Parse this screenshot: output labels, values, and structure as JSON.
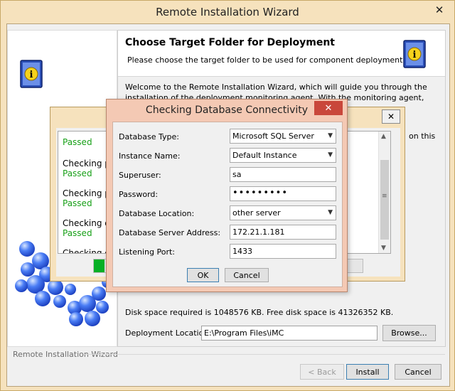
{
  "main": {
    "title": "Remote Installation Wizard",
    "close_glyph": "✕",
    "header_title": "Choose Target Folder for Deployment",
    "header_subtitle": "Please choose the target folder to be used for component deployment.",
    "intro_text": "Welcome to the Remote Installation Wizard, which will guide you through the installation of the deployment monitoring agent. With the monitoring agent, you can",
    "intro_tail": "on this",
    "disk_space": "Disk space required is 1048576 KB. Free disk space is 41326352 KB.",
    "deployment_location_label": "Deployment Location:",
    "deployment_location_value": "E:\\Program Files\\iMC",
    "browse_label": "Browse...",
    "footer_label": "Remote Installation Wizard",
    "back_label": "< Back",
    "install_label": "Install",
    "cancel_label": "Cancel"
  },
  "progress_dialog": {
    "close_glyph": "✕",
    "entries": [
      {
        "line1": "",
        "line2": "Passed"
      },
      {
        "line1": "Checking p",
        "line2": "Passed"
      },
      {
        "line1": "Checking p",
        "line2": "Passed"
      },
      {
        "line1": "Checking d",
        "line2": "Passed"
      },
      {
        "line1": "Checking d",
        "line2": ""
      }
    ]
  },
  "db_dialog": {
    "title": "Checking Database Connectivity",
    "close_glyph": "✕",
    "database_type_label": "Database Type:",
    "database_type_value": "Microsoft SQL Server",
    "instance_name_label": "Instance Name:",
    "instance_name_value": "Default Instance",
    "superuser_label": "Superuser:",
    "superuser_value": "sa",
    "password_label": "Password:",
    "password_value": "•••••••••",
    "database_location_label": "Database Location:",
    "database_location_value": "other server",
    "server_address_label": "Database Server Address:",
    "server_address_value": "172.21.1.181",
    "listening_port_label": "Listening Port:",
    "listening_port_value": "1433",
    "ok_label": "OK",
    "cancel_label": "Cancel"
  },
  "icons": {
    "dropdown": "▼",
    "scroll_up": "▲",
    "scroll_down": "▼",
    "scroll_grip": "≡"
  },
  "colors": {
    "window_frame": "#f6e2bd",
    "dialog_frame": "#f4c9b4",
    "close_button_red": "#c9473b",
    "passed_green": "#18a018",
    "progress_green": "#06b025"
  }
}
